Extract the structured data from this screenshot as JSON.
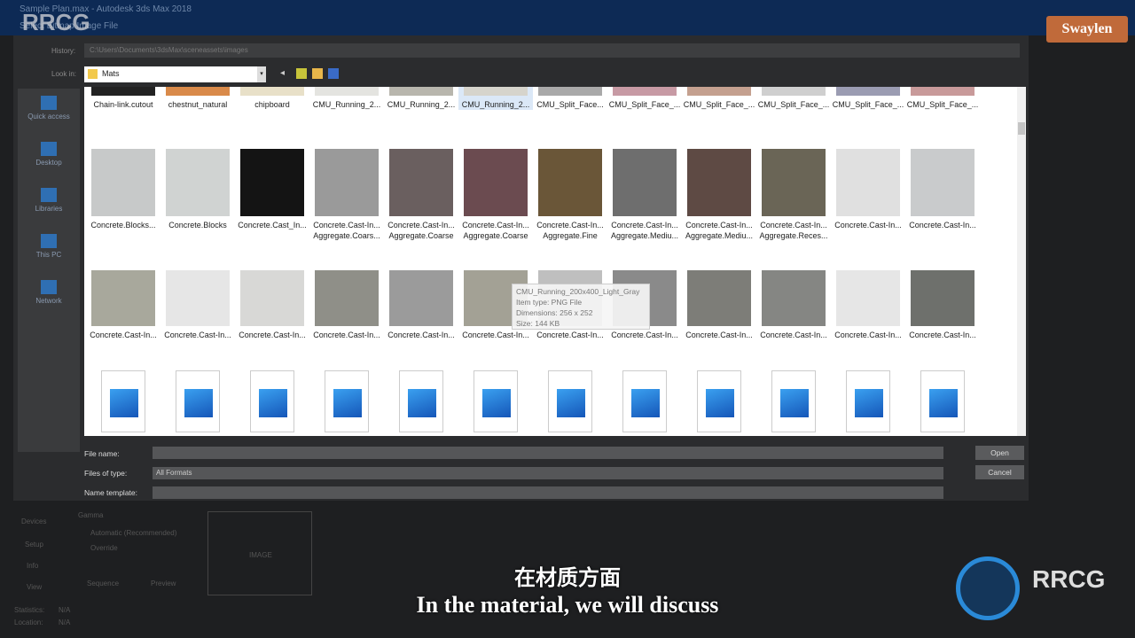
{
  "window": {
    "title": "Sample Plan.max - Autodesk 3ds Max 2018",
    "dialog_title": "Select Bitmap Image File",
    "watermark": "RRCG",
    "brand": "Swaylen"
  },
  "history": {
    "label": "History:",
    "value": "C:\\Users\\Documents\\3dsMax\\sceneassets\\images"
  },
  "look_in": {
    "label": "Look in:",
    "value": "Mats"
  },
  "places": [
    {
      "label": "Quick access",
      "icon": "star-icon"
    },
    {
      "label": "Desktop",
      "icon": "desktop-icon"
    },
    {
      "label": "Libraries",
      "icon": "libraries-icon"
    },
    {
      "label": "This PC",
      "icon": "computer-icon"
    },
    {
      "label": "Network",
      "icon": "network-icon"
    }
  ],
  "rows": [
    [
      {
        "l1": "Chain-link.cutout",
        "c": "#222"
      },
      {
        "l1": "chestnut_natural",
        "c": "#d98a4a"
      },
      {
        "l1": "chipboard",
        "c": "#e8e0c8"
      },
      {
        "l1": "CMU_Running_2...",
        "c": "#e4e4e0"
      },
      {
        "l1": "CMU_Running_2...",
        "c": "#b8b6ad"
      },
      {
        "l1": "CMU_Running_2...",
        "c": "#d6d4cc",
        "sel": true
      },
      {
        "l1": "CMU_Split_Face...",
        "c": "#a9a9a9"
      },
      {
        "l1": "CMU_Split_Face_...",
        "c": "#c79aa4"
      },
      {
        "l1": "CMU_Split_Face_...",
        "c": "#c4a08f"
      },
      {
        "l1": "CMU_Split_Face_...",
        "c": "#cfcfcf"
      },
      {
        "l1": "CMU_Split_Face_...",
        "c": "#9b9cb2"
      },
      {
        "l1": "CMU_Split_Face_...",
        "c": "#c89a9a"
      }
    ],
    [
      {
        "l1": "Concrete.Blocks...",
        "c": "#c7c9c9"
      },
      {
        "l1": "Concrete.Blocks",
        "c": "#d0d3d2"
      },
      {
        "l1": "Concrete.Cast_In...",
        "c": "#141414"
      },
      {
        "l1": "Concrete.Cast-In...",
        "l2": "Aggregate.Coars...",
        "c": "#9a9a9a"
      },
      {
        "l1": "Concrete.Cast-In...",
        "l2": "Aggregate.Coarse",
        "c": "#6a5f5f"
      },
      {
        "l1": "Concrete.Cast-In...",
        "l2": "Aggregate.Coarse",
        "c": "#6b4b50"
      },
      {
        "l1": "Concrete.Cast-In...",
        "l2": "Aggregate.Fine",
        "c": "#6a5638"
      },
      {
        "l1": "Concrete.Cast-In...",
        "l2": "Aggregate.Mediu...",
        "c": "#6e6e6e"
      },
      {
        "l1": "Concrete.Cast-In...",
        "l2": "Aggregate.Mediu...",
        "c": "#5e4a44"
      },
      {
        "l1": "Concrete.Cast-In...",
        "l2": "Aggregate.Reces...",
        "c": "#6a6556"
      },
      {
        "l1": "Concrete.Cast-In...",
        "c": "#e0e0e0"
      },
      {
        "l1": "Concrete.Cast-In...",
        "c": "#c9cbcc"
      }
    ],
    [
      {
        "l1": "Concrete.Cast-In...",
        "c": "#a8a89c"
      },
      {
        "l1": "Concrete.Cast-In...",
        "c": "#e6e6e6"
      },
      {
        "l1": "Concrete.Cast-In...",
        "c": "#d8d8d6"
      },
      {
        "l1": "Concrete.Cast-In...",
        "c": "#8f8f88"
      },
      {
        "l1": "Concrete.Cast-In...",
        "c": "#9b9b9b"
      },
      {
        "l1": "Concrete.Cast-In...",
        "c": "#a3a195"
      },
      {
        "l1": "Concrete.Cast-In...",
        "c": "#bfbfbf"
      },
      {
        "l1": "Concrete.Cast-In...",
        "c": "#8a8a8a"
      },
      {
        "l1": "Concrete.Cast-In...",
        "c": "#7d7d78"
      },
      {
        "l1": "Concrete.Cast-In...",
        "c": "#858683"
      },
      {
        "l1": "Concrete.Cast-In...",
        "c": "#e6e6e6"
      },
      {
        "l1": "Concrete.Cast-In...",
        "c": "#6e706c"
      }
    ]
  ],
  "icon_row_count": 12,
  "tooltip": {
    "name": "CMU_Running_200x400_Light_Gray",
    "type": "Item type: PNG File",
    "dims": "Dimensions: 256 x 252",
    "size": "Size: 144 KB"
  },
  "footer": {
    "file_name_label": "File name:",
    "file_name_value": "",
    "type_label": "Files of type:",
    "type_value": "All Formats",
    "template_label": "Name template:",
    "open": "Open",
    "cancel": "Cancel"
  },
  "lower": {
    "gamma": "Gamma",
    "auto": "Automatic (Recommended)",
    "override": "Override",
    "image": "IMAGE",
    "preview": "Preview",
    "statistics": "Statistics:",
    "stat_val": "N/A",
    "location": "Location:",
    "loc_val": "N/A",
    "devices": "Devices",
    "setup": "Setup",
    "info": "Info",
    "view": "View",
    "sequence": "Sequence"
  },
  "subtitle": {
    "zh": "在材质方面",
    "en": "In the material, we will discuss"
  }
}
